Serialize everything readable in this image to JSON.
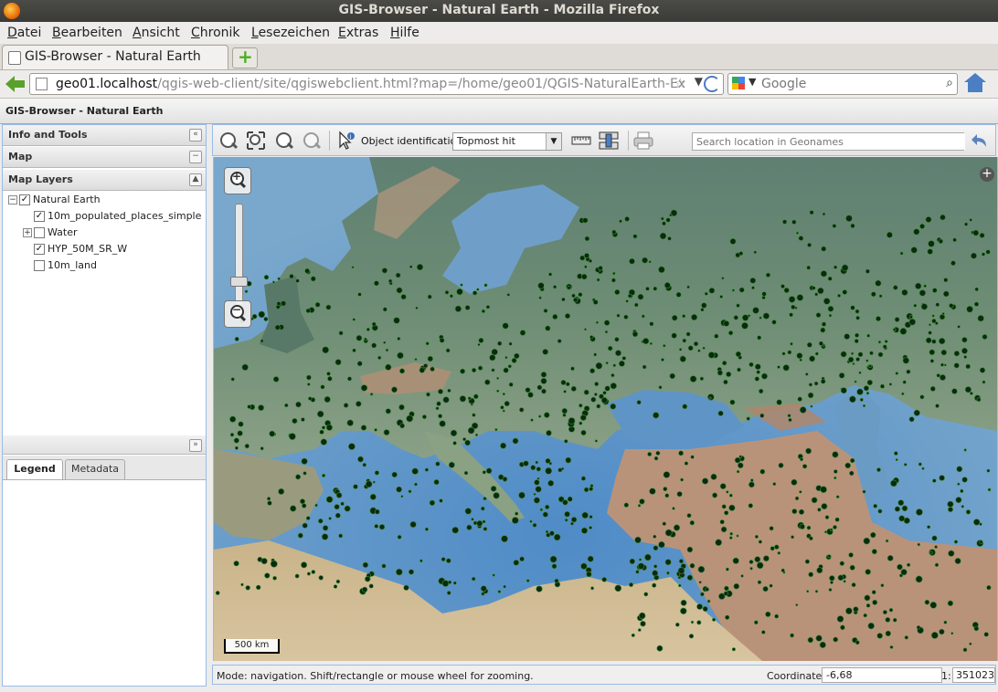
{
  "window": {
    "title": "GIS-Browser - Natural Earth - Mozilla Firefox"
  },
  "menu": [
    "Datei",
    "Bearbeiten",
    "Ansicht",
    "Chronik",
    "Lesezeichen",
    "Extras",
    "Hilfe"
  ],
  "tab": {
    "label": "GIS-Browser - Natural Earth"
  },
  "url": {
    "host": "geo01.localhost",
    "rest": "/qgis-web-client/site/qgiswebclient.html?map=/home/geo01/QGIS-NaturalEarth-Ex"
  },
  "search": {
    "placeholder": "Google"
  },
  "app": {
    "header": "GIS-Browser - Natural Earth",
    "info_tools": "Info and Tools",
    "map_panel": "Map",
    "map_layers": "Map Layers",
    "layers": [
      {
        "label": "Natural Earth",
        "checked": true,
        "expand": "−"
      },
      {
        "label": "10m_populated_places_simple",
        "checked": true
      },
      {
        "label": "Water",
        "checked": false,
        "expand": "+"
      },
      {
        "label": "HYP_50M_SR_W",
        "checked": true
      },
      {
        "label": "10m_land",
        "checked": false
      }
    ],
    "tabs": {
      "legend": "Legend",
      "metadata": "Metadata"
    }
  },
  "toolbar": {
    "object_id_label": "Object identification:",
    "object_id_value": "Topmost hit",
    "geonames_placeholder": "Search location in Geonames"
  },
  "map": {
    "scale_label": "500 km"
  },
  "status": {
    "mode": "Mode: navigation. Shift/rectangle or mouse wheel for zooming.",
    "coordinate_label": "Coordinate:",
    "coordinate_value": "-6,68",
    "scale_prefix": "1:",
    "scale_value": "351023"
  },
  "colors": {
    "panel_border": "#99bbe8",
    "sea": "#6e9fc6",
    "land": "#6b8a72",
    "relief": "#c59a7a",
    "point": "#0b2a10"
  }
}
